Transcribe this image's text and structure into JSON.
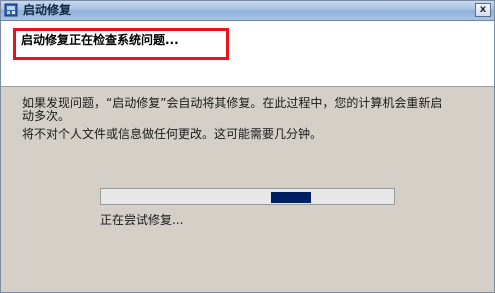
{
  "window": {
    "title": "启动修复",
    "close_label": "x"
  },
  "header": {
    "heading": "启动修复正在检查系统问题..."
  },
  "content": {
    "paragraph_1": "如果发现问题，“启动修复”会自动将其修复。在此过程中，您的计算机会重新启动多次。",
    "paragraph_2": "将不对个人文件或信息做任何更改。这可能需要几分钟。"
  },
  "progress": {
    "type": "indeterminate-marquee",
    "block_position_fraction": 0.67,
    "status_text": "正在尝试修复..."
  },
  "colors": {
    "highlight_border": "#e8141b",
    "progress_block": "#001f63"
  },
  "icons": {
    "title": "startup-repair-icon"
  }
}
